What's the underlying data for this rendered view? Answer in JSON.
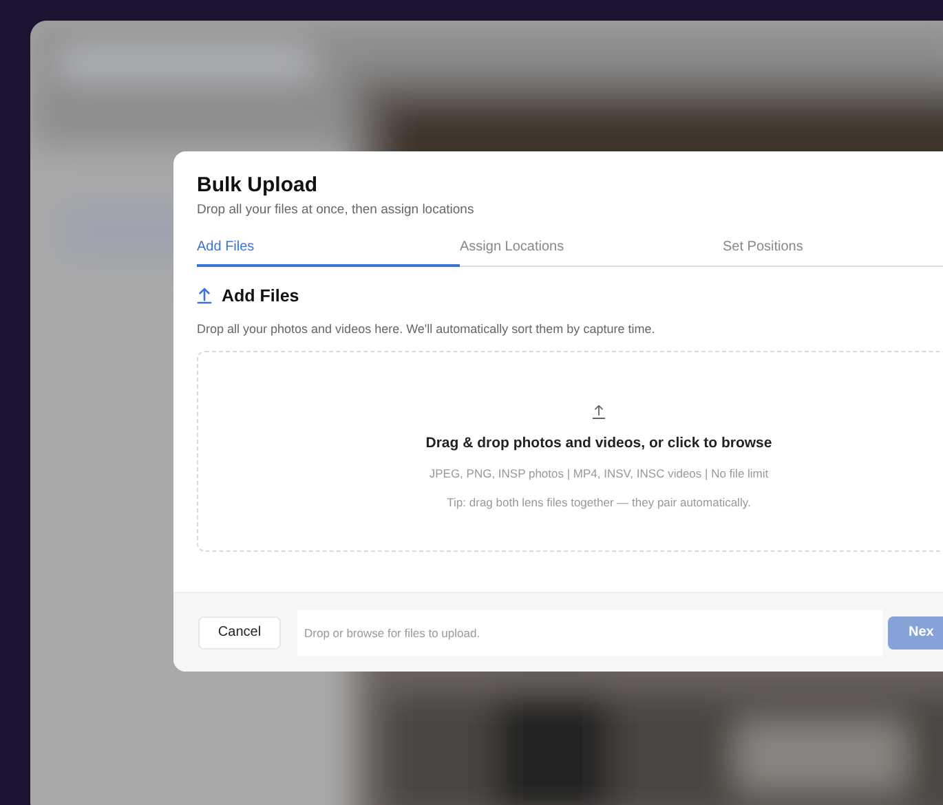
{
  "dialog": {
    "title": "Bulk Upload",
    "subtitle": "Drop all your files at once, then assign locations"
  },
  "tabs": [
    {
      "label": "Add Files",
      "selected": true
    },
    {
      "label": "Assign Locations",
      "selected": false
    },
    {
      "label": "Set Positions",
      "selected": false
    }
  ],
  "section": {
    "title": "Add Files",
    "description": "Drop all your photos and videos here. We'll automatically sort them by capture time."
  },
  "dropzone": {
    "title": "Drag & drop photos and videos, or click to browse",
    "formats": "JPEG, PNG, INSP photos | MP4, INSV, INSC videos | No file limit",
    "tip": "Tip: drag both lens files together — they pair automatically."
  },
  "footer": {
    "cancel": "Cancel",
    "status": "Drop or browse for files to upload.",
    "next": {
      "label": "Nex",
      "disabled": true
    }
  }
}
